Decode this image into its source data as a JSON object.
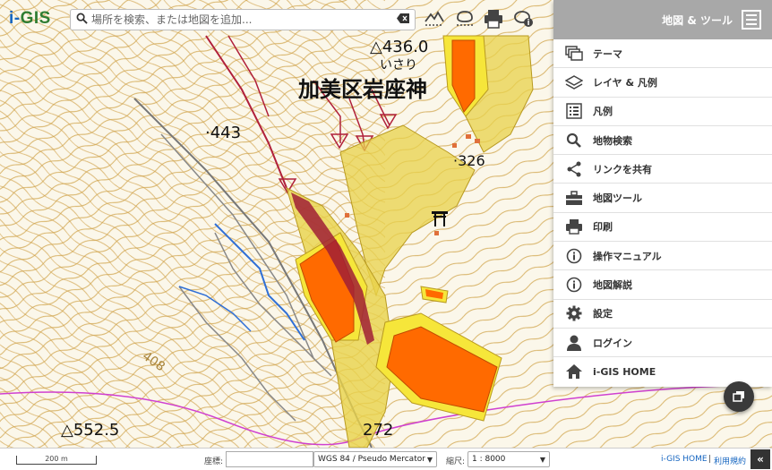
{
  "app": {
    "logo_i": "i-",
    "logo_rest": "GIS"
  },
  "search": {
    "placeholder": "場所を検索、または地図を追加..."
  },
  "toolbar": {
    "icons": [
      "profile-icon",
      "layer-icon",
      "print-icon",
      "info-bubble-icon"
    ]
  },
  "panel": {
    "title": "地図 & ツール",
    "items": [
      {
        "label": "テーマ",
        "icon": "theme-icon"
      },
      {
        "label": "レイヤ & 凡例",
        "icon": "layers-icon"
      },
      {
        "label": "凡例",
        "icon": "legend-icon"
      },
      {
        "label": "地物検索",
        "icon": "search-icon"
      },
      {
        "label": "リンクを共有",
        "icon": "share-icon"
      },
      {
        "label": "地図ツール",
        "icon": "toolbox-icon"
      },
      {
        "label": "印刷",
        "icon": "print-icon"
      },
      {
        "label": "操作マニュアル",
        "icon": "info-icon"
      },
      {
        "label": "地図解説",
        "icon": "info-icon"
      },
      {
        "label": "設定",
        "icon": "gear-icon"
      },
      {
        "label": "ログイン",
        "icon": "user-icon"
      },
      {
        "label": "i-GIS HOME",
        "icon": "home-icon"
      }
    ]
  },
  "map": {
    "place_name": "加美区岩座神",
    "place_reading": "いさり",
    "elevations": [
      "△436.0",
      "·443",
      "·326",
      "△552.5",
      "272",
      "408"
    ]
  },
  "bottom": {
    "scale_label": "200 m",
    "coord_label": "座標:",
    "coord_value": "",
    "projection": "WGS 84 / Pseudo Mercator",
    "scale_prefix": "縮尺:",
    "scale_value": "1 : 8000",
    "home_link": "i-GIS HOME",
    "terms_link": "利用規約",
    "collapse": "«"
  },
  "colors": {
    "panel_header": "#a8a8a8",
    "hazard_red": "#ff6a00",
    "hazard_yellow": "#f2e23a",
    "contour": "#c9a24a"
  }
}
